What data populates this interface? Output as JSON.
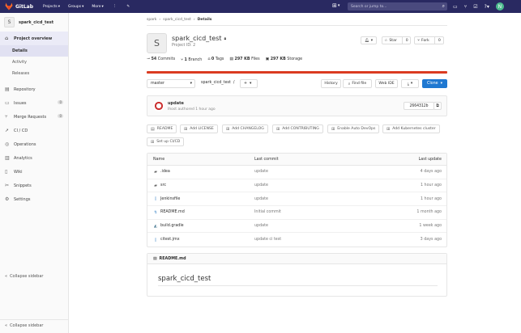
{
  "topbar": {
    "brand": "GitLab",
    "menu": [
      {
        "label": "Projects"
      },
      {
        "label": "Groups"
      },
      {
        "label": "More"
      }
    ],
    "search_placeholder": "Search or jump to...",
    "avatar_initial": "N"
  },
  "sidebar": {
    "project_initial": "S",
    "project_name": "spark_cicd_test",
    "overview_label": "Project overview",
    "sub_items": [
      "Details",
      "Activity",
      "Releases"
    ],
    "items": [
      {
        "label": "Repository",
        "icon": "repository-icon"
      },
      {
        "label": "Issues",
        "icon": "issues-icon",
        "count": "0"
      },
      {
        "label": "Merge Requests",
        "icon": "merge-request-icon",
        "count": "0"
      },
      {
        "label": "CI / CD",
        "icon": "rocket-icon"
      },
      {
        "label": "Operations",
        "icon": "operations-icon"
      },
      {
        "label": "Analytics",
        "icon": "chart-icon"
      },
      {
        "label": "Wiki",
        "icon": "book-icon"
      },
      {
        "label": "Snippets",
        "icon": "snippets-icon"
      },
      {
        "label": "Settings",
        "icon": "settings-icon"
      }
    ],
    "collapse_label": "Collapse sidebar"
  },
  "breadcrumb": [
    "spark",
    "spark_cicd_test",
    "Details"
  ],
  "project": {
    "initial": "S",
    "name": "spark_cicd_test",
    "id_text": "Project ID: 2",
    "star_label": "Star",
    "star_count": "0",
    "fork_label": "Fork",
    "fork_count": "0"
  },
  "stats": {
    "commits": "54",
    "commits_label": "Commits",
    "branches": "1",
    "branches_label": "Branch",
    "tags": "0",
    "tags_label": "Tags",
    "files": "297 KB",
    "files_label": "Files",
    "storage": "297 KB",
    "storage_label": "Storage"
  },
  "toolbar": {
    "branch": "master",
    "path": "spark_cicd_test",
    "path_sep": "/",
    "history": "History",
    "find_file": "Find file",
    "web_ide": "Web IDE",
    "clone": "Clone"
  },
  "commit": {
    "title": "update",
    "subtitle": "Ihost authored 1 hour ago",
    "sha": "2664312b"
  },
  "quick_actions": [
    "README",
    "Add LICENSE",
    "Add CHANGELOG",
    "Add CONTRIBUTING",
    "Enable Auto DevOps",
    "Add Kubernetes cluster",
    "Set up CI/CD"
  ],
  "files": {
    "headers": [
      "Name",
      "Last commit",
      "Last update"
    ],
    "rows": [
      {
        "name": ".idea",
        "commit": "update",
        "updated": "4 days ago",
        "icon": "folder-icon"
      },
      {
        "name": "src",
        "commit": "update",
        "updated": "1 hour ago",
        "icon": "folder-icon"
      },
      {
        "name": "Jenkinsfile",
        "commit": "update",
        "updated": "1 hour ago",
        "icon": "file-icon"
      },
      {
        "name": "README.md",
        "commit": "Initial commit",
        "updated": "1 month ago",
        "icon": "markdown-icon"
      },
      {
        "name": "build.gradle",
        "commit": "update",
        "updated": "1 week ago",
        "icon": "gradle-icon"
      },
      {
        "name": "citest.jmx",
        "commit": "update ci test",
        "updated": "3 days ago",
        "icon": "file-icon"
      }
    ]
  },
  "readme": {
    "filename": "README.md",
    "heading": "spark_cicd_test"
  },
  "colors": {
    "navbar": "#292961",
    "accent": "#1f78d1",
    "danger": "#db3b21"
  }
}
